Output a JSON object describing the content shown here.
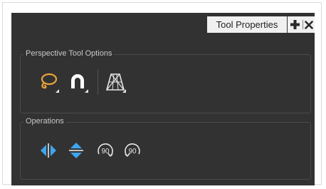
{
  "panel": {
    "tab_title": "Tool Properties",
    "actions": [
      {
        "icon": "plus-icon"
      },
      {
        "icon": "close-icon"
      }
    ]
  },
  "perspective_group": {
    "title": "Perspective Tool Options",
    "tools": [
      {
        "icon": "lasso-icon",
        "color": "#e8a33a"
      },
      {
        "icon": "magnet-icon",
        "color": "#ffffff"
      },
      {
        "icon": "perspective-grid-icon",
        "color": "#e6e6e6"
      }
    ]
  },
  "operations_group": {
    "title": "Operations",
    "operations": [
      {
        "icon": "flip-horizontal-icon",
        "color": "#3ea6f0"
      },
      {
        "icon": "flip-vertical-icon",
        "color": "#3ea6f0"
      },
      {
        "icon": "rotate-90-cw-icon",
        "label": "90"
      },
      {
        "icon": "rotate-90-ccw-icon",
        "label": "90"
      }
    ]
  },
  "colors": {
    "panel_bg": "#323232",
    "tab_bg": "#f0f0f0",
    "accent_orange": "#e8a33a",
    "accent_blue": "#3ea6f0"
  }
}
